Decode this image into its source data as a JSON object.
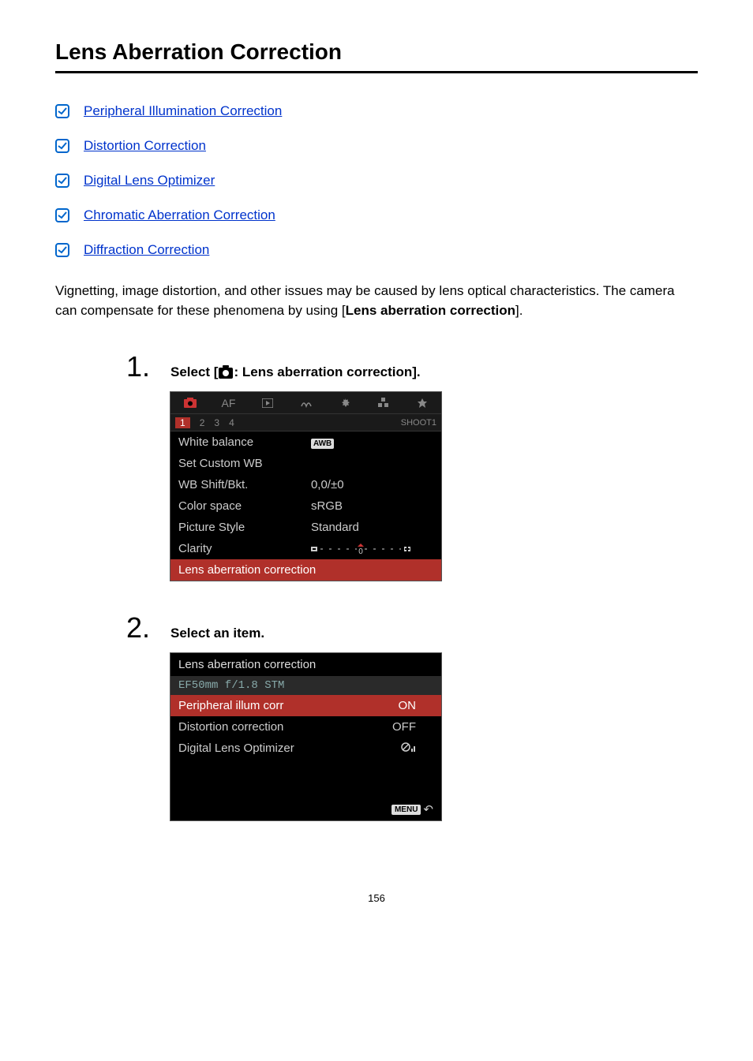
{
  "title": "Lens Aberration Correction",
  "toc": [
    "Peripheral Illumination Correction",
    "Distortion Correction",
    "Digital Lens Optimizer",
    "Chromatic Aberration Correction",
    "Diffraction Correction"
  ],
  "intro_pre": "Vignetting, image distortion, and other issues may be caused by lens optical characteristics. The camera can compensate for these phenomena by using [",
  "intro_bold": "Lens aberration correction",
  "intro_post": "].",
  "steps": {
    "step1": {
      "num": "1.",
      "title_pre": "Select [",
      "title_post": ": Lens aberration correction].",
      "menu": {
        "tabs_right": "SHOOT1",
        "tabs_af": "AF",
        "subtabs": [
          "1",
          "2",
          "3",
          "4"
        ],
        "rows": [
          {
            "label": "White balance",
            "value_type": "awb",
            "value": "AWB"
          },
          {
            "label": "Set Custom WB",
            "value": ""
          },
          {
            "label": "WB Shift/Bkt.",
            "value": "0,0/±0"
          },
          {
            "label": "Color space",
            "value": "sRGB"
          },
          {
            "label": "Picture Style",
            "value": "Standard"
          },
          {
            "label": "Clarity",
            "value_type": "clarity"
          }
        ],
        "highlight": "Lens aberration correction"
      }
    },
    "step2": {
      "num": "2.",
      "title": "Select an item.",
      "screen": {
        "title": "Lens aberration correction",
        "lens": "EF50mm f/1.8 STM",
        "rows": [
          {
            "label": "Peripheral illum corr",
            "value": "ON",
            "hl": true
          },
          {
            "label": "Distortion correction",
            "value": "OFF"
          },
          {
            "label": "Digital Lens Optimizer",
            "value_type": "dlo"
          }
        ],
        "footer": "MENU"
      }
    }
  },
  "page_num": "156"
}
